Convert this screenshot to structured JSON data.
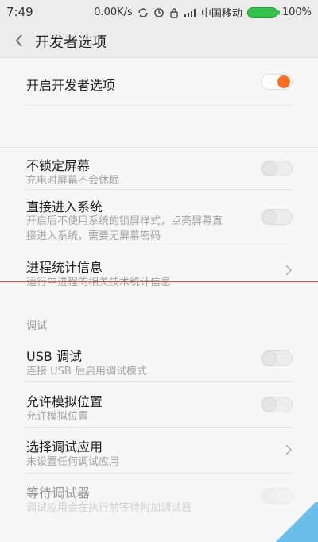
{
  "status_bar": {
    "time": "7:49",
    "speed": "0.00K/s",
    "carrier": "中国移动",
    "battery": "100%"
  },
  "header": {
    "title": "开发者选项"
  },
  "rows": {
    "developer": {
      "label": "开启开发者选项",
      "enabled": true
    },
    "no_lock": {
      "label": "不锁定屏幕",
      "sub": "充电时屏幕不会休眠",
      "enabled": false
    },
    "direct_enter": {
      "label": "直接进入系统",
      "sub1": "开启后不使用系统的锁屏样式，点亮屏幕直",
      "sub2": "接进入系统，需要无屏幕密码",
      "enabled": false
    },
    "proc_stats": {
      "label": "进程统计信息",
      "sub": "运行中进程的相关技术统计信息"
    },
    "debug_section": "调试",
    "usb_debug": {
      "label": "USB 调试",
      "sub": "连接 USB 后启用调试模式",
      "enabled": false
    },
    "mock_location": {
      "label": "允许模拟位置",
      "sub": "允许模拟位置",
      "enabled": false
    },
    "select_debug_app": {
      "label": "选择调试应用",
      "sub": "未设置任何调试应用"
    },
    "wait_debugger": {
      "label": "等待调试器",
      "sub": "调试应用会在执行前等待附加调试器",
      "enabled": false
    }
  },
  "colors": {
    "accent": "#ff6c23",
    "redline": "#e8473f"
  }
}
